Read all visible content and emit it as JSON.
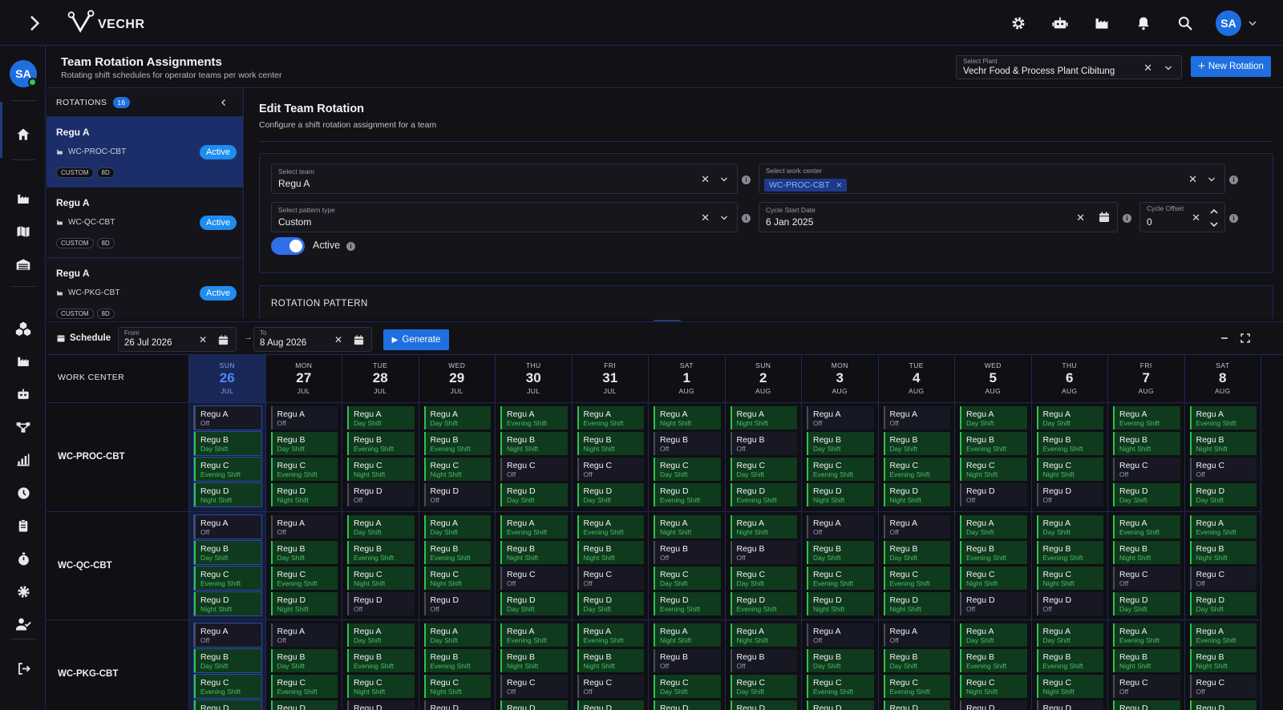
{
  "app": {
    "brand": "VECHR",
    "user_initials": "SA"
  },
  "topbar_icons": [
    "gear-icon",
    "robot-icon",
    "factory-icon",
    "bell-icon",
    "search-icon"
  ],
  "sidebar_icons": [
    "home-icon",
    "factory-icon",
    "map-icon",
    "warehouse-icon",
    "cubes-icon",
    "factory-icon",
    "robot-icon",
    "flow-icon",
    "bar-chart-icon",
    "clock-icon",
    "clipboard-icon",
    "stopwatch-icon",
    "gear-icon",
    "user-check-icon",
    "logout-icon"
  ],
  "header": {
    "title": "Team Rotation Assignments",
    "subtitle": "Rotating shift schedules for operator teams per work center",
    "plant_label": "Select Plant",
    "plant_value": "Vechr Food & Process Plant Cibitung",
    "new_rotation": "New Rotation"
  },
  "rotations": {
    "label": "ROTATIONS",
    "count": "16",
    "items": [
      {
        "name": "Regu A",
        "work_center": "WC-PROC-CBT",
        "status": "Active",
        "tags": [
          "CUSTOM",
          "8D"
        ]
      },
      {
        "name": "Regu A",
        "work_center": "WC-QC-CBT",
        "status": "Active",
        "tags": [
          "CUSTOM",
          "8D"
        ]
      },
      {
        "name": "Regu A",
        "work_center": "WC-PKG-CBT",
        "status": "Active",
        "tags": [
          "CUSTOM",
          "8D"
        ]
      }
    ]
  },
  "edit": {
    "title": "Edit Team Rotation",
    "subtitle": "Configure a shift rotation assignment for a team",
    "team_label": "Select team",
    "team_value": "Regu A",
    "wc_label": "Select work center",
    "wc_chip": "WC-PROC-CBT",
    "pattern_label": "Select pattern type",
    "pattern_value": "Custom",
    "start_label": "Cycle Start Date",
    "start_value": "6 Jan 2025",
    "offset_label": "Cycle Offset",
    "offset_value": "0",
    "active_label": "Active",
    "pattern_section": "ROTATION PATTERN"
  },
  "schedule": {
    "label": "Schedule",
    "from_label": "From",
    "from_value": "26 Jul 2026",
    "to_label": "To",
    "to_value": "8 Aug 2026",
    "generate": "Generate",
    "work_center_header": "WORK CENTER"
  },
  "days": [
    {
      "dow": "SUN",
      "day": "26",
      "mon": "JUL",
      "today": true
    },
    {
      "dow": "MON",
      "day": "27",
      "mon": "JUL"
    },
    {
      "dow": "TUE",
      "day": "28",
      "mon": "JUL"
    },
    {
      "dow": "WED",
      "day": "29",
      "mon": "JUL"
    },
    {
      "dow": "THU",
      "day": "30",
      "mon": "JUL"
    },
    {
      "dow": "FRI",
      "day": "31",
      "mon": "JUL"
    },
    {
      "dow": "SAT",
      "day": "1",
      "mon": "AUG"
    },
    {
      "dow": "SUN",
      "day": "2",
      "mon": "AUG"
    },
    {
      "dow": "MON",
      "day": "3",
      "mon": "AUG"
    },
    {
      "dow": "TUE",
      "day": "4",
      "mon": "AUG"
    },
    {
      "dow": "WED",
      "day": "5",
      "mon": "AUG"
    },
    {
      "dow": "THU",
      "day": "6",
      "mon": "AUG"
    },
    {
      "dow": "FRI",
      "day": "7",
      "mon": "AUG"
    },
    {
      "dow": "SAT",
      "day": "8",
      "mon": "AUG"
    }
  ],
  "teams": [
    "Regu A",
    "Regu B",
    "Regu C",
    "Regu D"
  ],
  "work_centers": [
    "WC-PROC-CBT",
    "WC-QC-CBT",
    "WC-PKG-CBT"
  ],
  "shift_names": [
    "Off",
    "Day Shift",
    "Evening Shift",
    "Night Shift"
  ],
  "shifts": [
    [
      0,
      0,
      1,
      1,
      2,
      2,
      3,
      3,
      0,
      0,
      1,
      1,
      2,
      2
    ],
    [
      1,
      1,
      2,
      2,
      3,
      3,
      0,
      0,
      1,
      1,
      2,
      2,
      3,
      3
    ],
    [
      2,
      2,
      3,
      3,
      0,
      0,
      1,
      1,
      2,
      2,
      3,
      3,
      0,
      0
    ],
    [
      3,
      3,
      0,
      0,
      1,
      1,
      2,
      2,
      3,
      3,
      0,
      0,
      1,
      1
    ]
  ]
}
